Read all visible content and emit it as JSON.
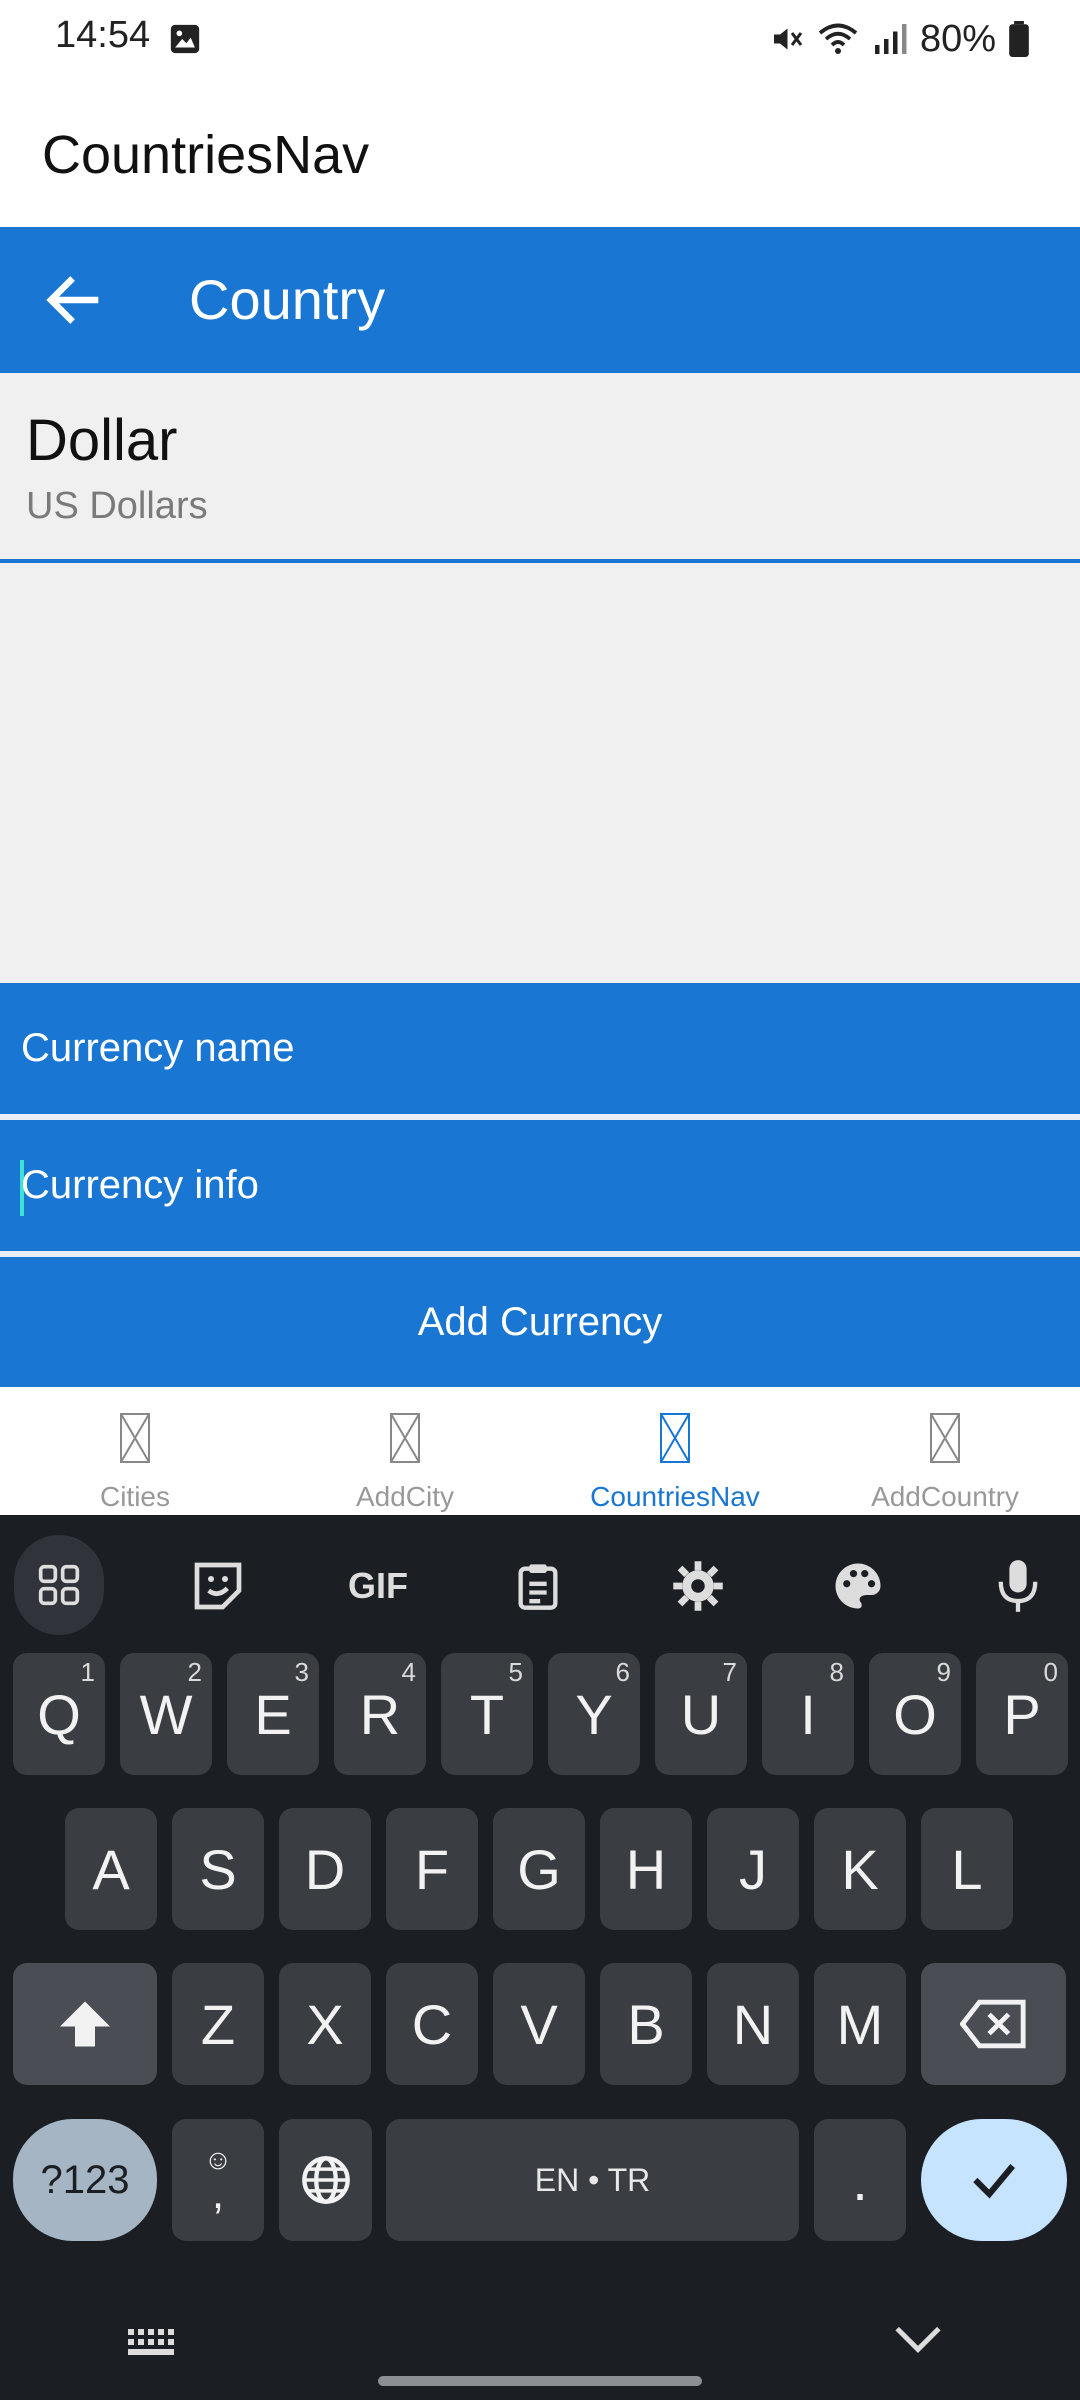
{
  "status_bar": {
    "time": "14:54",
    "battery": "80%",
    "icons": [
      "image-icon",
      "mute-icon",
      "wifi-icon",
      "signal-icon",
      "battery-icon"
    ]
  },
  "app": {
    "title": "CountriesNav"
  },
  "toolbar": {
    "title": "Country",
    "back_icon": "back-arrow-icon"
  },
  "list": {
    "items": [
      {
        "title": "Dollar",
        "subtitle": "US Dollars"
      }
    ]
  },
  "form": {
    "currency_name_placeholder": "Currency name",
    "currency_info_placeholder": "Currency info",
    "add_button": "Add Currency"
  },
  "tabs": [
    {
      "label": "Cities",
      "active": false
    },
    {
      "label": "AddCity",
      "active": false
    },
    {
      "label": "CountriesNav",
      "active": true
    },
    {
      "label": "AddCountry",
      "active": false
    }
  ],
  "keyboard": {
    "row1": [
      {
        "k": "Q",
        "h": "1"
      },
      {
        "k": "W",
        "h": "2"
      },
      {
        "k": "E",
        "h": "3"
      },
      {
        "k": "R",
        "h": "4"
      },
      {
        "k": "T",
        "h": "5"
      },
      {
        "k": "Y",
        "h": "6"
      },
      {
        "k": "U",
        "h": "7"
      },
      {
        "k": "I",
        "h": "8"
      },
      {
        "k": "O",
        "h": "9"
      },
      {
        "k": "P",
        "h": "0"
      }
    ],
    "row2": [
      "A",
      "S",
      "D",
      "F",
      "G",
      "H",
      "J",
      "K",
      "L"
    ],
    "row3": [
      "Z",
      "X",
      "C",
      "V",
      "B",
      "N",
      "M"
    ],
    "sym_key": "?123",
    "comma_key": ",",
    "space_label": "EN • TR",
    "period_key": ".",
    "colors": {
      "accent": "#1976d2",
      "keyboard_bg": "#1b1e22",
      "key_bg": "#3a3d42",
      "enter_bg": "#c6e3ff"
    }
  }
}
